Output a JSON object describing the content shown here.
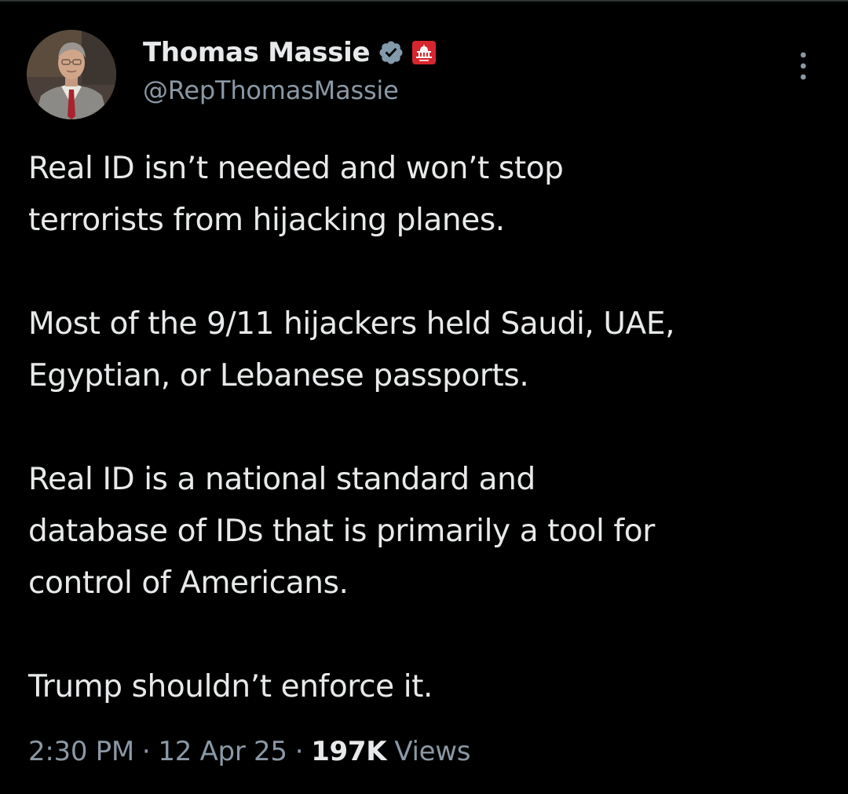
{
  "author": {
    "display_name": "Thomas Massie",
    "handle": "@RepThomasMassie",
    "verified_icon": "verified-badge-icon",
    "affiliation_icon": "us-capitol-icon"
  },
  "tweet": {
    "paragraphs": [
      [
        "Real ID isn’t needed and won’t stop",
        "terrorists from hijacking planes."
      ],
      [
        "Most of the 9/11 hijackers held Saudi, UAE,",
        "Egyptian, or Lebanese passports."
      ],
      [
        "Real ID is a national standard and",
        "database of IDs that is primarily a tool for",
        "control of Americans."
      ],
      [
        "Trump shouldn’t enforce it."
      ]
    ]
  },
  "meta": {
    "time": "2:30 PM",
    "separator": "·",
    "date": "12 Apr 25",
    "views_count": "197K",
    "views_label": "Views"
  },
  "colors": {
    "background": "#000000",
    "primary_text": "#e7e9ea",
    "secondary_text": "#8b98a5",
    "verified_badge": "#829aab",
    "affiliation_badge": "#d7262e"
  }
}
